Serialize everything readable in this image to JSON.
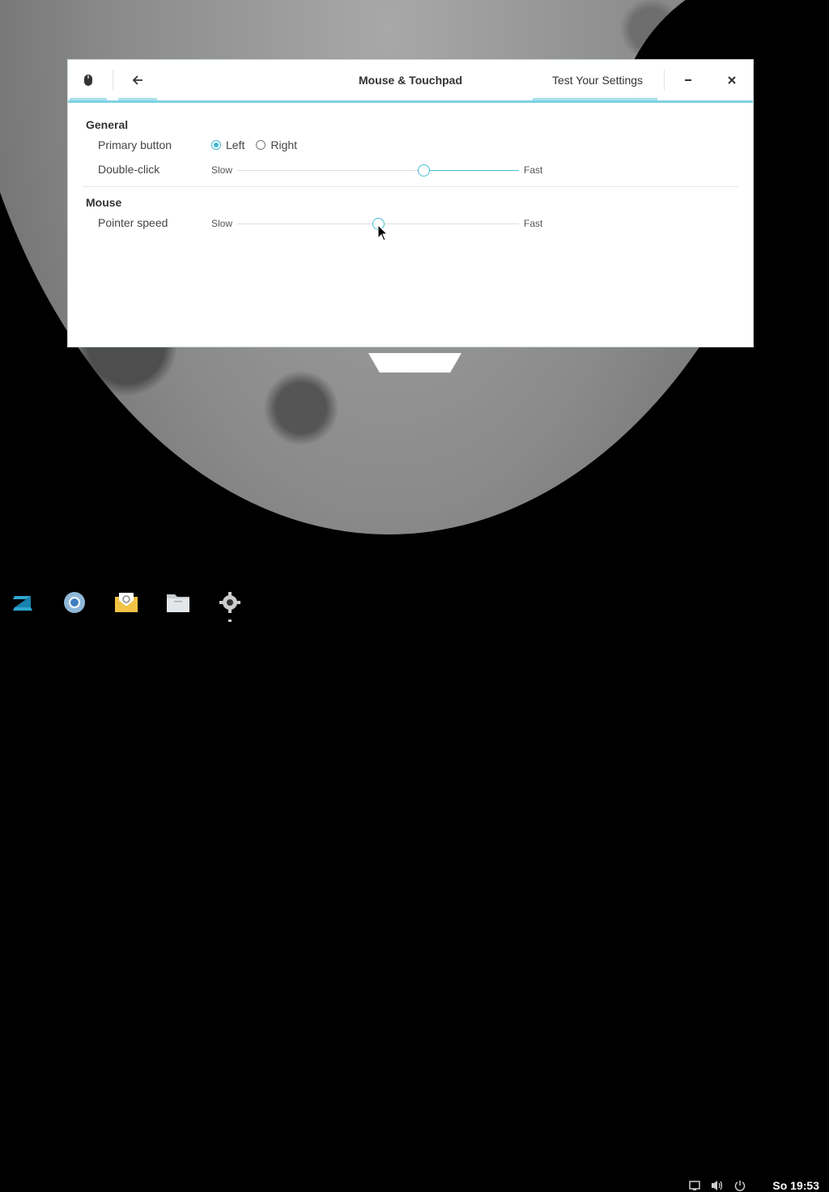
{
  "window": {
    "title": "Mouse & Touchpad",
    "test_button_label": "Test Your Settings"
  },
  "general": {
    "heading": "General",
    "primary_button_label": "Primary button",
    "option_left": "Left",
    "option_right": "Right",
    "selected": "Left",
    "double_click_label": "Double-click",
    "double_click_value": 0.66
  },
  "mouse": {
    "heading": "Mouse",
    "pointer_speed_label": "Pointer speed",
    "pointer_speed_value": 0.5
  },
  "slider_labels": {
    "slow": "Slow",
    "fast": "Fast"
  },
  "taskbar": {
    "apps": [
      "zorin-menu-icon",
      "chromium-icon",
      "mail-icon",
      "files-icon",
      "settings-icon"
    ],
    "clock": "So 19:53"
  },
  "colors": {
    "accent": "#48bcd6"
  }
}
